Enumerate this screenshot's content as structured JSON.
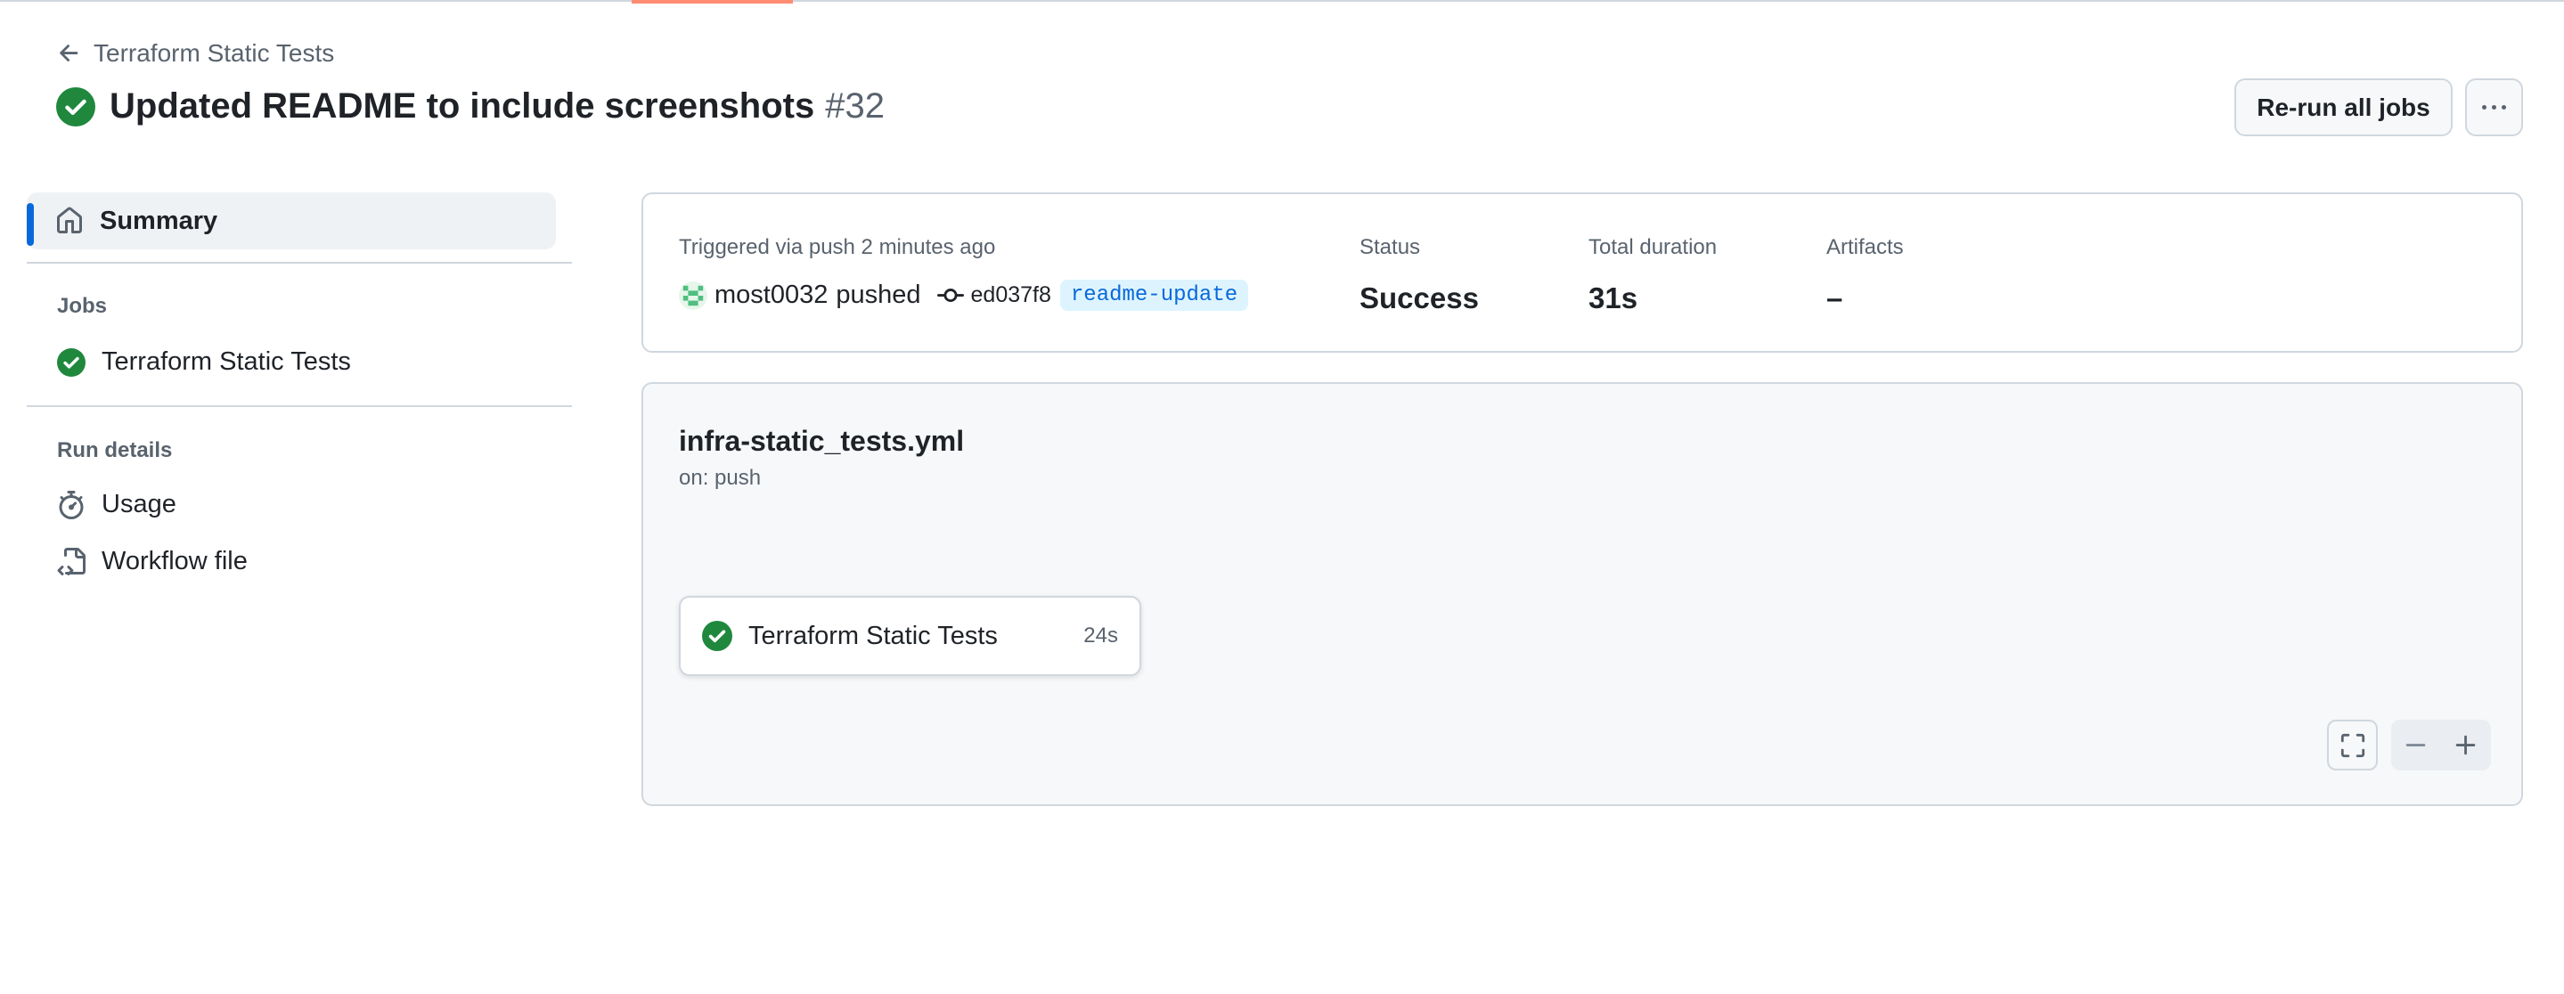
{
  "nav": {
    "back_label": "Terraform Static Tests"
  },
  "header": {
    "title": "Updated README to include screenshots",
    "run_number": "#32",
    "rerun_button": "Re-run all jobs"
  },
  "sidebar": {
    "summary_label": "Summary",
    "jobs_heading": "Jobs",
    "jobs": [
      {
        "label": "Terraform Static Tests",
        "status": "success"
      }
    ],
    "run_details_heading": "Run details",
    "run_details": [
      {
        "label": "Usage",
        "icon": "stopwatch-icon"
      },
      {
        "label": "Workflow file",
        "icon": "file-code-icon"
      }
    ]
  },
  "summary": {
    "triggered_text": "Triggered via push 2 minutes ago",
    "actor": "most0032",
    "action": "pushed",
    "commit_sha": "ed037f8",
    "branch": "readme-update",
    "status_label": "Status",
    "status_value": "Success",
    "duration_label": "Total duration",
    "duration_value": "31s",
    "artifacts_label": "Artifacts",
    "artifacts_value": "–"
  },
  "workflow": {
    "file_name": "infra-static_tests.yml",
    "trigger": "on: push",
    "job": {
      "name": "Terraform Static Tests",
      "duration": "24s",
      "status": "success"
    }
  },
  "colors": {
    "success": "#1f883d",
    "accent": "#0969da",
    "tab_underline": "#fd8c73",
    "branch_bg": "#ddf4ff"
  }
}
